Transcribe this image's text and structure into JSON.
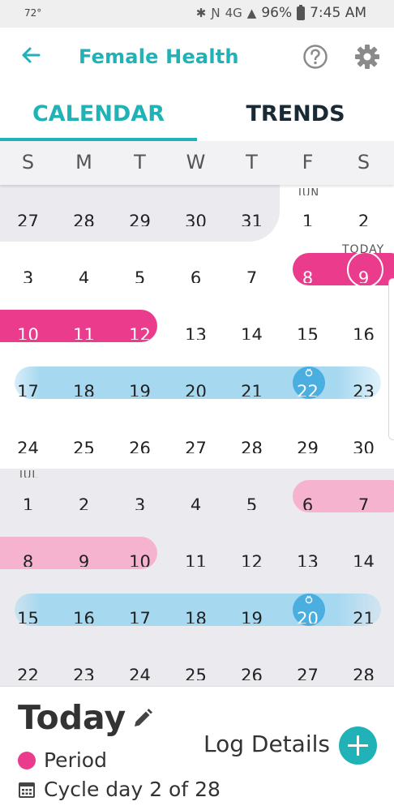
{
  "status_bar": {
    "temperature": "72°",
    "network": "4G",
    "battery": "96%",
    "time": "7:45 AM"
  },
  "app_bar": {
    "title": "Female Health",
    "icons": [
      "back-arrow-icon",
      "help-icon",
      "settings-gear-icon"
    ]
  },
  "tabs": [
    {
      "label": "CALENDAR",
      "selected": true
    },
    {
      "label": "TRENDS",
      "selected": false
    }
  ],
  "weekdays": [
    "S",
    "M",
    "T",
    "W",
    "T",
    "F",
    "S"
  ],
  "calendar": {
    "month_labels": [
      "JUN",
      "JUL"
    ],
    "today_label": "TODAY",
    "weeks": [
      {
        "days": [
          "27",
          "28",
          "29",
          "30",
          "31",
          "1",
          "2"
        ]
      },
      {
        "days": [
          "3",
          "4",
          "5",
          "6",
          "7",
          "8",
          "9"
        ]
      },
      {
        "days": [
          "10",
          "11",
          "12",
          "13",
          "14",
          "15",
          "16"
        ]
      },
      {
        "days": [
          "17",
          "18",
          "19",
          "20",
          "21",
          "22",
          "23"
        ]
      },
      {
        "days": [
          "24",
          "25",
          "26",
          "27",
          "28",
          "29",
          "30"
        ]
      },
      {
        "days": [
          "1",
          "2",
          "3",
          "4",
          "5",
          "6",
          "7"
        ]
      },
      {
        "days": [
          "8",
          "9",
          "10",
          "11",
          "12",
          "13",
          "14"
        ]
      },
      {
        "days": [
          "15",
          "16",
          "17",
          "18",
          "19",
          "20",
          "21"
        ]
      },
      {
        "days": [
          "22",
          "23",
          "24",
          "25",
          "26",
          "27",
          "28"
        ]
      }
    ],
    "colors": {
      "period": "#ea3b8c",
      "predicted_period": "#f6b3d0",
      "fertile_window": "#a6d8f0",
      "ovulation": "#4aaee0",
      "past_month_shade": "#ebebef",
      "accent": "#20b2b6"
    }
  },
  "today_panel": {
    "title": "Today",
    "legend_period": "Period",
    "cycle_text": "Cycle day 2 of 28",
    "log_label": "Log Details"
  }
}
